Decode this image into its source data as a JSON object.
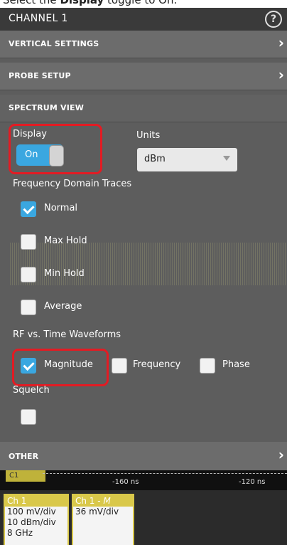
{
  "instruction": {
    "prefix": "Select the ",
    "bold": "Display",
    "suffix": " toggle to On."
  },
  "panel": {
    "title": "CHANNEL 1",
    "help_icon": "question-circle-icon",
    "sections": {
      "vertical": "VERTICAL SETTINGS",
      "probe": "PROBE SETUP",
      "spectrum": "SPECTRUM VIEW",
      "other": "OTHER"
    },
    "display_label": "Display",
    "display_toggle": "On",
    "units_label": "Units",
    "units_value": "dBm",
    "freq_domain_label": "Frequency Domain Traces",
    "traces": [
      {
        "label": "Normal",
        "checked": true
      },
      {
        "label": "Max Hold",
        "checked": false
      },
      {
        "label": "Min Hold",
        "checked": false
      },
      {
        "label": "Average",
        "checked": false
      }
    ],
    "rf_time_label": "RF vs. Time Waveforms",
    "rf_options": [
      {
        "label": "Magnitude",
        "checked": true
      },
      {
        "label": "Frequency",
        "checked": false
      },
      {
        "label": "Phase",
        "checked": false
      }
    ],
    "squelch_label": "Squelch"
  },
  "timeline": {
    "tab": "C1",
    "ticks": [
      "-160 ns",
      "-120 ns"
    ]
  },
  "badges": [
    {
      "header": "Ch 1",
      "rows": [
        "100 mV/div",
        "10 dBm/div",
        "8 GHz"
      ]
    },
    {
      "header_prefix": "Ch 1 - ",
      "header_em": "M",
      "rows": [
        "36 mV/div"
      ]
    }
  ],
  "colors": {
    "accent": "#3aa7e0",
    "highlight": "#e31b23",
    "channel": "#d9c84a"
  }
}
